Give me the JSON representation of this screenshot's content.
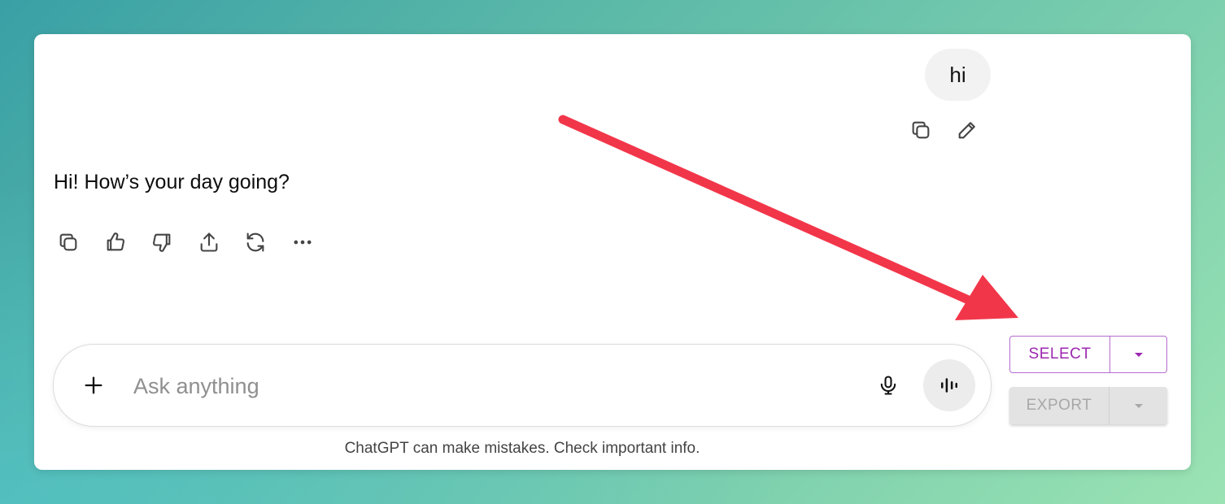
{
  "user_message": {
    "text": "hi"
  },
  "user_actions": [
    {
      "icon": "copy-icon"
    },
    {
      "icon": "edit-icon"
    }
  ],
  "assistant_message": {
    "text": "Hi! How’s your day going?"
  },
  "assistant_actions": [
    {
      "icon": "copy-icon"
    },
    {
      "icon": "thumbs-up-icon"
    },
    {
      "icon": "thumbs-down-icon"
    },
    {
      "icon": "share-icon"
    },
    {
      "icon": "regenerate-icon"
    },
    {
      "icon": "more-icon"
    }
  ],
  "composer": {
    "placeholder": "Ask anything",
    "value": "",
    "add_icon": "plus-icon",
    "mic_icon": "microphone-icon",
    "voice_icon": "voice-mode-icon"
  },
  "disclaimer": "ChatGPT can make mistakes. Check important info.",
  "extension": {
    "select_label": "SELECT",
    "export_label": "EXPORT"
  },
  "colors": {
    "annotation_arrow": "#f2364a",
    "select_accent": "#9c27b0",
    "export_disabled": "#a8a8a8"
  }
}
